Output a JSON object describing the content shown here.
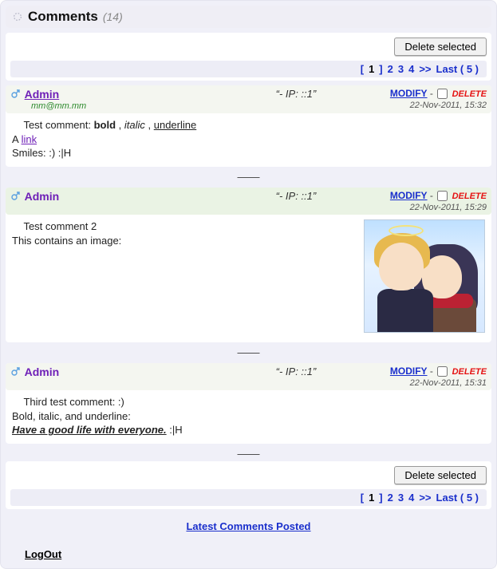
{
  "header": {
    "title": "Comments",
    "count": "(14)"
  },
  "buttons": {
    "delete_selected": "Delete selected"
  },
  "pager": {
    "current": "1",
    "pages": [
      "2",
      "3",
      "4"
    ],
    "next": ">>",
    "last": "Last ( 5 )"
  },
  "comments": [
    {
      "author": "Admin",
      "email": "mm@mm.mm",
      "ip": "“- IP: ::1”",
      "modify": "MODIFY",
      "delete": "DELETE",
      "timestamp": "22-Nov-2011,  15:32",
      "body": {
        "line1_pre": "Test comment: ",
        "bold": "bold",
        "sep1": " , ",
        "italic": "italic",
        "sep2": " , ",
        "underline": "underline",
        "line2_pre": "A ",
        "link": "link",
        "line3": "Smiles: :) :|H"
      }
    },
    {
      "author": "Admin",
      "ip": "“- IP: ::1”",
      "modify": "MODIFY",
      "delete": "DELETE",
      "timestamp": "22-Nov-2011,  15:29",
      "body": {
        "line1": "Test comment 2",
        "line2": "This contains an image:"
      }
    },
    {
      "author": "Admin",
      "ip": "“- IP: ::1”",
      "modify": "MODIFY",
      "delete": "DELETE",
      "timestamp": "22-Nov-2011,  15:31",
      "body": {
        "line1": "Third test comment: :)",
        "line2": "Bold, italic, and underline:",
        "styled": "Have a good life with everyone.",
        "tail": " :|H"
      }
    }
  ],
  "links": {
    "latest": "Latest Comments Posted",
    "logout": "LogOut"
  }
}
